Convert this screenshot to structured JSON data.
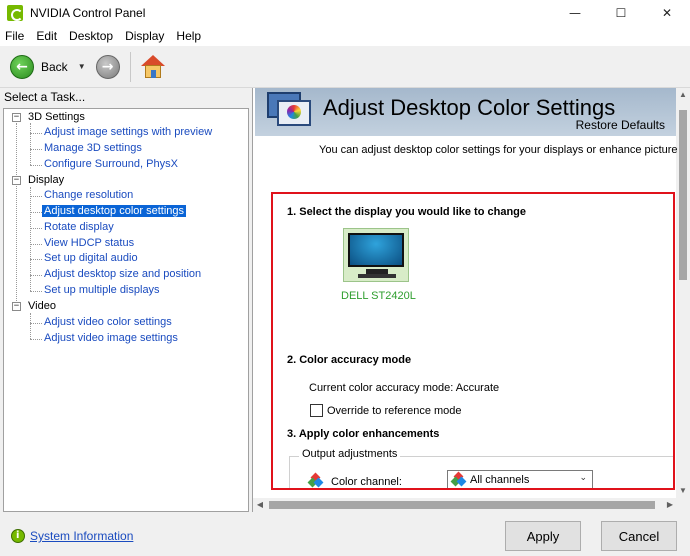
{
  "window": {
    "title": "NVIDIA Control Panel",
    "controls": {
      "minimize": "—",
      "maximize": "☐",
      "close": "✕"
    }
  },
  "menu": [
    "File",
    "Edit",
    "Desktop",
    "Display",
    "Help"
  ],
  "toolbar": {
    "back_label": "Back",
    "back_icon": "back-arrow-icon",
    "forward_icon": "forward-arrow-icon",
    "home_icon": "home-icon"
  },
  "sidebar": {
    "title": "Select a Task...",
    "categories": [
      {
        "label": "3D Settings",
        "items": [
          "Adjust image settings with preview",
          "Manage 3D settings",
          "Configure Surround, PhysX"
        ]
      },
      {
        "label": "Display",
        "items": [
          "Change resolution",
          "Adjust desktop color settings",
          "Rotate display",
          "View HDCP status",
          "Set up digital audio",
          "Adjust desktop size and position",
          "Set up multiple displays"
        ]
      },
      {
        "label": "Video",
        "items": [
          "Adjust video color settings",
          "Adjust video image settings"
        ]
      }
    ],
    "selected": "Adjust desktop color settings"
  },
  "content": {
    "header_title": "Adjust Desktop Color Settings",
    "restore_defaults": "Restore Defaults",
    "intro": "You can adjust desktop color settings for your displays or enhance picture quality",
    "section1": "1. Select the display you would like to change",
    "display_name": "DELL ST2420L",
    "section2": "2. Color accuracy mode",
    "current_mode": "Current color accuracy mode: Accurate",
    "override_label": "Override to reference mode",
    "override_checked": false,
    "section3": "3. Apply color enhancements",
    "output_adjustments": "Output adjustments",
    "color_channel_label": "Color channel:",
    "color_channel_value": "All channels",
    "highlight_color": "#e0121b"
  },
  "footer": {
    "system_info": "System Information",
    "apply": "Apply",
    "cancel": "Cancel"
  },
  "colors": {
    "nvidia_green": "#76b900",
    "link_blue": "#1a4bbf",
    "selection_blue": "#0a64d6",
    "display_label_green": "#2e9e2e"
  }
}
